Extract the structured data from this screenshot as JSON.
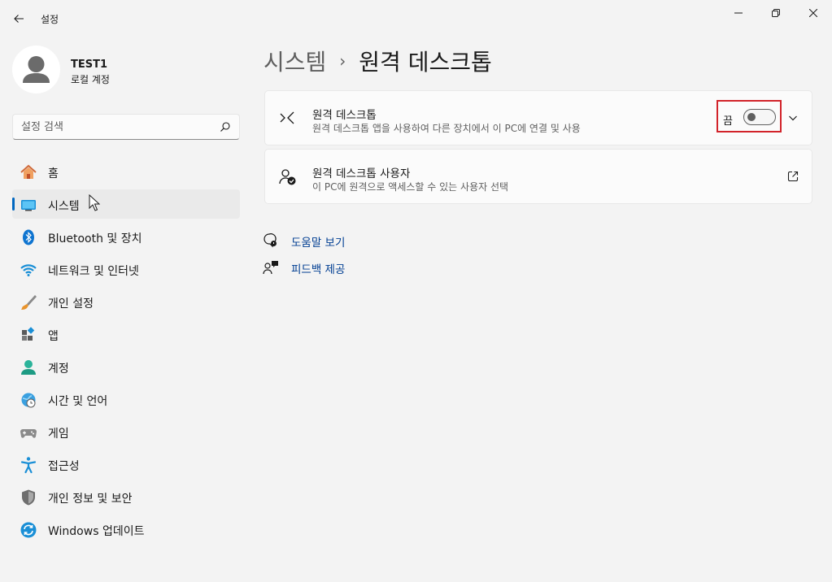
{
  "window": {
    "app_title": "설정"
  },
  "user": {
    "name": "TEST1",
    "account_type": "로컬 계정"
  },
  "search": {
    "placeholder": "설정 검색"
  },
  "sidebar": {
    "items": [
      {
        "label": "홈",
        "icon": "home-icon"
      },
      {
        "label": "시스템",
        "icon": "system-icon",
        "selected": true
      },
      {
        "label": "Bluetooth 및 장치",
        "icon": "bluetooth-icon"
      },
      {
        "label": "네트워크 및 인터넷",
        "icon": "wifi-icon"
      },
      {
        "label": "개인 설정",
        "icon": "brush-icon"
      },
      {
        "label": "앱",
        "icon": "apps-icon"
      },
      {
        "label": "계정",
        "icon": "account-icon"
      },
      {
        "label": "시간 및 언어",
        "icon": "time-language-icon"
      },
      {
        "label": "게임",
        "icon": "gamepad-icon"
      },
      {
        "label": "접근성",
        "icon": "accessibility-icon"
      },
      {
        "label": "개인 정보 및 보안",
        "icon": "shield-icon"
      },
      {
        "label": "Windows 업데이트",
        "icon": "update-icon"
      }
    ]
  },
  "breadcrumb": {
    "parent": "시스템",
    "separator": "›",
    "current": "원격 데스크톱"
  },
  "cards": {
    "remote_desktop": {
      "title": "원격 데스크톱",
      "description": "원격 데스크톱 앱을 사용하여 다른 장치에서 이 PC에 연결 및 사용",
      "toggle_label": "끔",
      "toggle_on": false
    },
    "remote_users": {
      "title": "원격 데스크톱 사용자",
      "description": "이 PC에 원격으로 액세스할 수 있는 사용자 선택"
    }
  },
  "links": {
    "help": "도움말 보기",
    "feedback": "피드백 제공"
  },
  "colors": {
    "accent": "#0067c0",
    "highlight_border": "#d2232a",
    "link": "#003e92"
  }
}
